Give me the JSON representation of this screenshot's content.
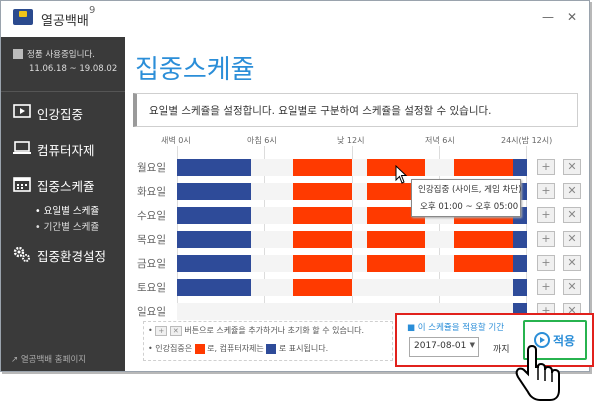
{
  "app": {
    "title": "열공백배",
    "version": "9"
  },
  "sidebar": {
    "user_line1": "정품 사용중입니다.",
    "user_line2": "11.06.18 ~ 19.08.02",
    "items": [
      {
        "label": "인강집중",
        "icon": "monitor-play-icon"
      },
      {
        "label": "컴퓨터자제",
        "icon": "laptop-icon"
      },
      {
        "label": "집중스케쥴",
        "icon": "calendar-icon"
      },
      {
        "label": "집중환경설정",
        "icon": "gears-icon"
      }
    ],
    "subitems": [
      "요일별 스케쥴",
      "기간별 스케쥴"
    ],
    "home_link": "열공백배 홈페이지"
  },
  "main": {
    "heading": "집중스케쥴",
    "info": "요일별 스케쥴을 설정합니다. 요일별로 구분하여 스케쥴을 설정할 수 있습니다.",
    "time_labels": [
      "새벽 0시",
      "아침 6시",
      "낮 12시",
      "저녁 6시",
      "24시(밤 12시)"
    ],
    "days": [
      "월요일",
      "화요일",
      "수요일",
      "목요일",
      "금요일",
      "토요일",
      "일요일"
    ],
    "tooltip_line1": "인강집중 (사이트, 게임 차단)",
    "tooltip_line2": "오후 01:00 ~ 오후 05:00",
    "legend_line1": "버튼으로 스케쥴을 추가하거나 초기화 할 수 있습니다.",
    "legend_line2a": "인강집중은",
    "legend_line2b": "로, 컴퓨터자제는",
    "legend_line2c": "로 표시됩니다.",
    "apply_label": "이 스케쥴을 적용할 기간",
    "date_value": "2017-08-01",
    "until": "까지",
    "apply_button": "적용"
  },
  "colors": {
    "blue": "#2e4b99",
    "red": "#ff3a00",
    "accent": "#2b8ed8",
    "highlight": "#e1211c"
  }
}
